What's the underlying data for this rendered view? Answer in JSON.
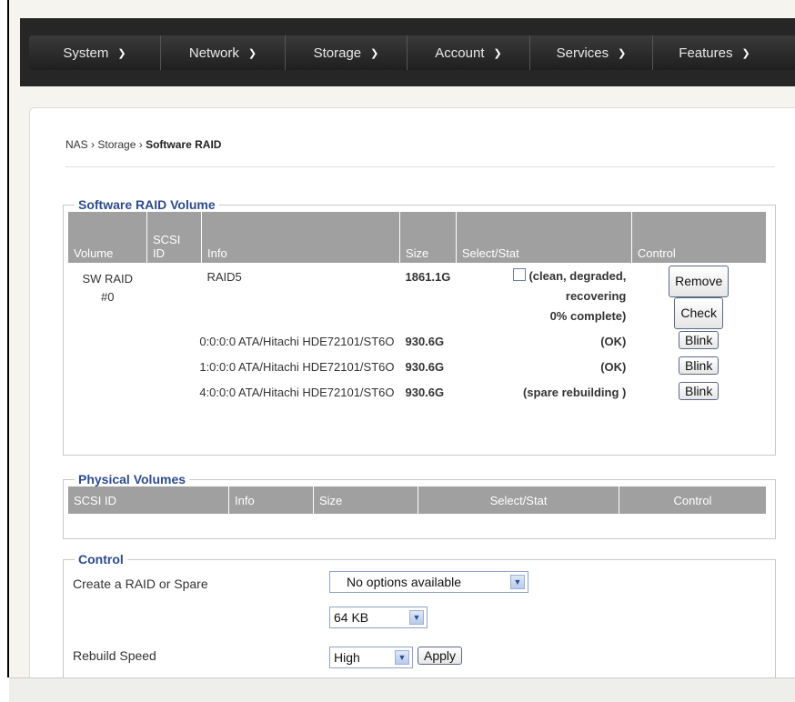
{
  "nav": {
    "items": [
      {
        "label": "System"
      },
      {
        "label": "Network"
      },
      {
        "label": "Storage"
      },
      {
        "label": "Account"
      },
      {
        "label": "Services"
      },
      {
        "label": "Features"
      }
    ]
  },
  "breadcrumb": {
    "root": "NAS",
    "section": "Storage",
    "current": "Software RAID",
    "sep": "›"
  },
  "raid_volume": {
    "legend": "Software RAID Volume",
    "headers": {
      "volume": "Volume",
      "scsi_1": "SCSI",
      "scsi_2": "ID",
      "info": "Info",
      "size": "Size",
      "select": "Select/Stat",
      "control": "Control"
    },
    "volume": {
      "name_1": "SW RAID",
      "name_2": "#0",
      "info": "RAID5",
      "size": "1861.1G",
      "status_1": "(clean, degraded,",
      "status_2": "recovering",
      "status_3": "0% complete)",
      "remove_label": "Remove",
      "check_label": "Check"
    },
    "disks": [
      {
        "scsi": "0:0:0:0",
        "info": "ATA/Hitachi HDE72101/ST6O",
        "size": "930.6G",
        "status": "(OK)",
        "button": "Blink"
      },
      {
        "scsi": "1:0:0:0",
        "info": "ATA/Hitachi HDE72101/ST6O",
        "size": "930.6G",
        "status": "(OK)",
        "button": "Blink"
      },
      {
        "scsi": "4:0:0:0",
        "info": "ATA/Hitachi HDE72101/ST6O",
        "size": "930.6G",
        "status": "(spare rebuilding )",
        "button": "Blink"
      }
    ]
  },
  "physical": {
    "legend": "Physical Volumes",
    "headers": {
      "scsi": "SCSI ID",
      "info": "Info",
      "size": "Size",
      "select": "Select/Stat",
      "control": "Control"
    }
  },
  "control": {
    "legend": "Control",
    "create_label": "Create a RAID or Spare",
    "create_value": "No options available",
    "chunk_value": "64 KB",
    "rebuild_label": "Rebuild Speed",
    "rebuild_value": "High",
    "apply_label": "Apply"
  }
}
